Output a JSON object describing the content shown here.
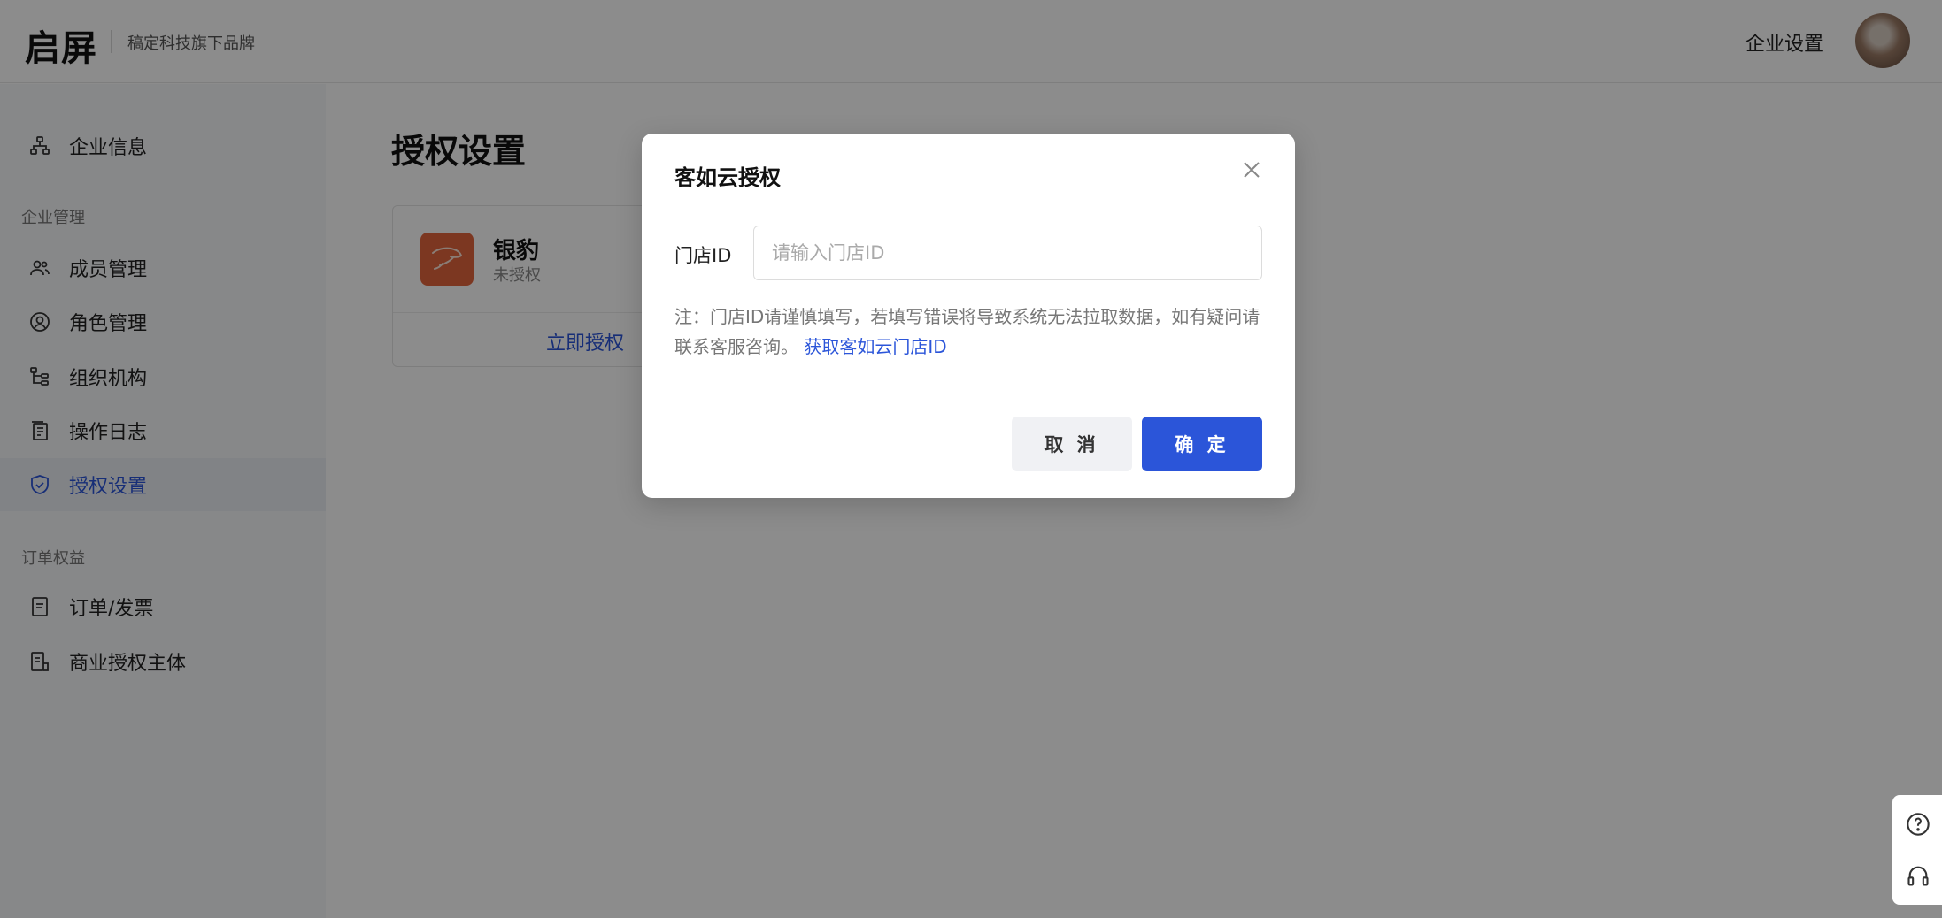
{
  "header": {
    "logo": "启屏",
    "brand_sub": "稿定科技旗下品牌",
    "settings_link": "企业设置"
  },
  "sidebar": {
    "items": [
      {
        "label": "企业信息",
        "icon": "org-chart-icon"
      },
      {
        "section": "企业管理"
      },
      {
        "label": "成员管理",
        "icon": "users-icon"
      },
      {
        "label": "角色管理",
        "icon": "user-circle-icon"
      },
      {
        "label": "组织机构",
        "icon": "tree-icon"
      },
      {
        "label": "操作日志",
        "icon": "log-icon"
      },
      {
        "label": "授权设置",
        "icon": "shield-icon",
        "active": true
      },
      {
        "section": "订单权益"
      },
      {
        "label": "订单/发票",
        "icon": "invoice-icon"
      },
      {
        "label": "商业授权主体",
        "icon": "business-doc-icon"
      }
    ]
  },
  "main": {
    "title": "授权设置",
    "card": {
      "name": "银豹",
      "status": "未授权",
      "action": "立即授权"
    }
  },
  "modal": {
    "title": "客如云授权",
    "field_label": "门店ID",
    "field_placeholder": "请输入门店ID",
    "field_value": "",
    "note_text": "注：门店ID请谨慎填写，若填写错误将导致系统无法拉取数据，如有疑问请联系客服咨询。",
    "note_link": "获取客如云门店ID",
    "cancel_label": "取 消",
    "ok_label": "确 定"
  },
  "colors": {
    "accent": "#2b55d9",
    "card_logo": "#e2643c",
    "overlay": "rgba(0,0,0,0.45)"
  }
}
